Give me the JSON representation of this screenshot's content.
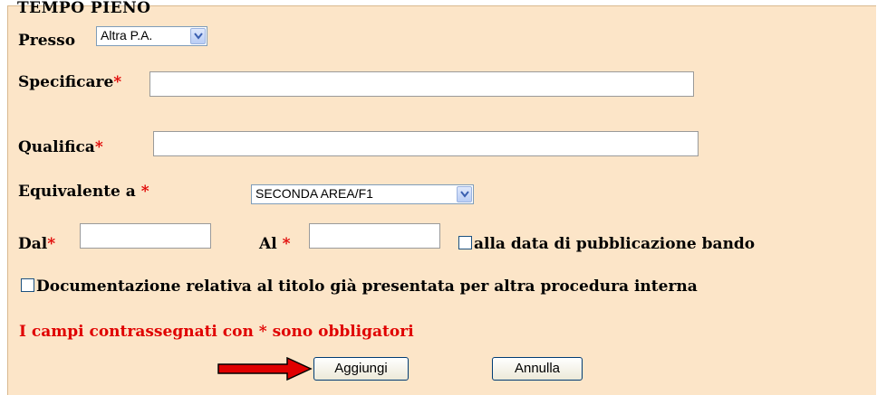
{
  "legend": "TEMPO PIENO",
  "presso": {
    "label": "Presso",
    "value": "Altra P.A."
  },
  "specificare": {
    "label": "Specificare",
    "required_mark": "*",
    "value": ""
  },
  "qualifica": {
    "label": "Qualifica",
    "required_mark": "*",
    "value": ""
  },
  "equivalente": {
    "label": "Equivalente a",
    "required_mark": "*",
    "value": "SECONDA AREA/F1"
  },
  "dal": {
    "label": "Dal",
    "required_mark": "*",
    "value": ""
  },
  "al": {
    "label": "Al",
    "required_mark": "*",
    "value": ""
  },
  "alla_data": {
    "label": "alla data di pubblicazione bando",
    "checked": false
  },
  "documentazione": {
    "label": "Documentazione relativa al titolo già presentata per altra procedura interna",
    "checked": false
  },
  "note": "I campi contrassegnati con * sono obbligatori",
  "buttons": {
    "add": "Aggiungi",
    "cancel": "Annulla"
  },
  "colors": {
    "panel": "#fce5c8",
    "required": "#e00000",
    "arrow": "#e00000"
  }
}
